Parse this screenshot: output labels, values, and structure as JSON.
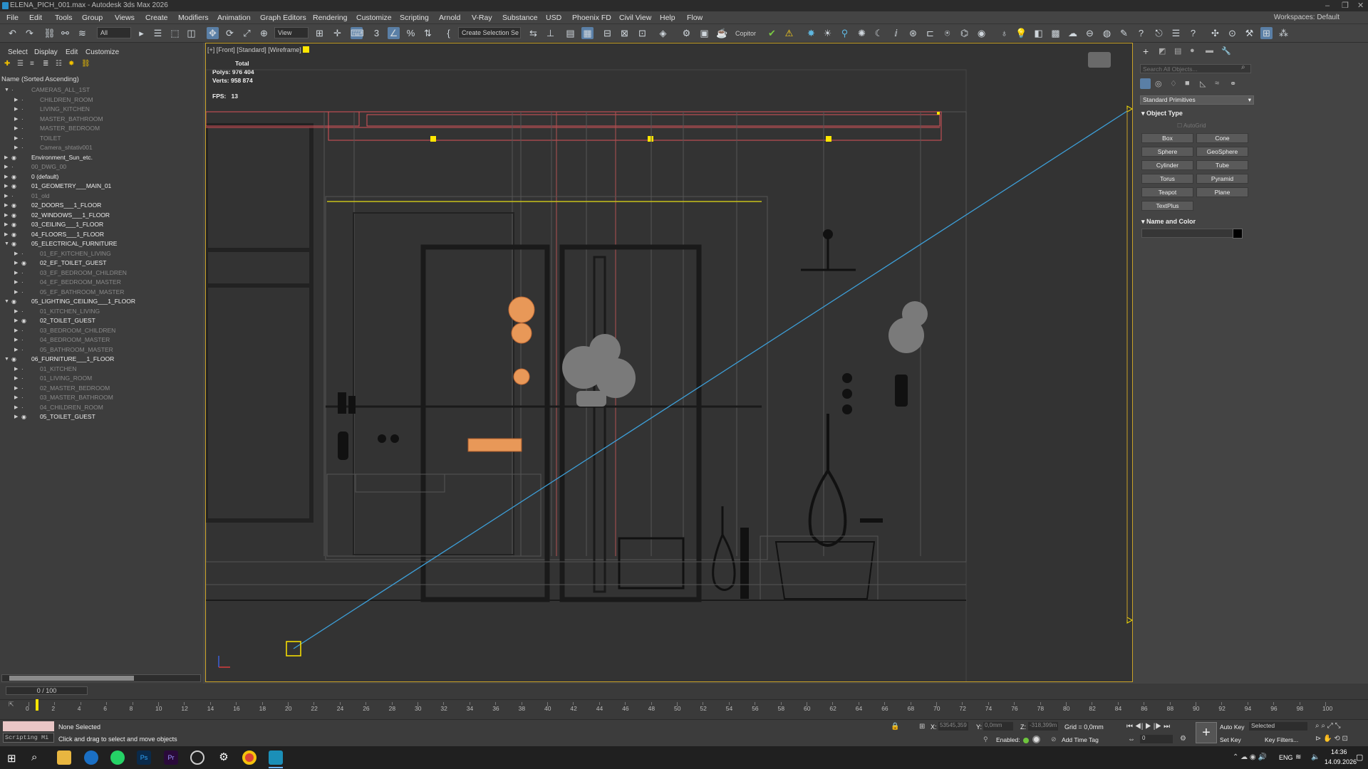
{
  "app": {
    "title": "ELENA_PICH_001.max - Autodesk 3ds Max 2026",
    "workspace_label": "Workspaces:",
    "workspace_value": "Default"
  },
  "menu": [
    "File",
    "Edit",
    "Tools",
    "Group",
    "Views",
    "Create",
    "Modifiers",
    "Animation",
    "Graph Editors",
    "Rendering",
    "Customize",
    "Scripting",
    "Arnold",
    "V-Ray",
    "Substance",
    "USD",
    "Phoenix FD",
    "Civil View",
    "Help",
    "Flow"
  ],
  "toolbar": {
    "filter_all": "All",
    "view_dropdown": "View",
    "selection_set": "Create Selection Se",
    "copitor": "Copitor"
  },
  "scene_explorer": {
    "tabs": [
      "Select",
      "Display",
      "Edit",
      "Customize"
    ],
    "sort_label": "Name (Sorted Ascending)",
    "items": [
      {
        "label": "CAMERAS_ALL_1ST",
        "dim": true,
        "level": 0,
        "expanded": true
      },
      {
        "label": "CHILDREN_ROOM",
        "dim": true,
        "level": 1
      },
      {
        "label": "LIVING_KITCHEN",
        "dim": true,
        "level": 1
      },
      {
        "label": "MASTER_BATHROOM",
        "dim": true,
        "level": 1
      },
      {
        "label": "MASTER_BEDROOM",
        "dim": true,
        "level": 1
      },
      {
        "label": "TOILET",
        "dim": true,
        "level": 1
      },
      {
        "label": "Camera_shtativ001",
        "dim": true,
        "level": 1
      },
      {
        "label": "Environment_Sun_etc.",
        "dim": false,
        "level": 0
      },
      {
        "label": "00_DWG_00",
        "dim": true,
        "level": 0
      },
      {
        "label": "0 (default)",
        "dim": false,
        "level": 0
      },
      {
        "label": "01_GEOMETRY___MAIN_01",
        "dim": false,
        "level": 0
      },
      {
        "label": "01_old",
        "dim": true,
        "level": 0
      },
      {
        "label": "02_DOORS___1_FLOOR",
        "dim": false,
        "level": 0
      },
      {
        "label": "02_WINDOWS___1_FLOOR",
        "dim": false,
        "level": 0
      },
      {
        "label": "03_CEILING___1_FLOOR",
        "dim": false,
        "level": 0
      },
      {
        "label": "04_FLOORS___1_FLOOR",
        "dim": false,
        "level": 0
      },
      {
        "label": "05_ELECTRICAL_FURNITURE",
        "dim": false,
        "level": 0,
        "expanded": true
      },
      {
        "label": "01_EF_KITCHEN_LIVING",
        "dim": true,
        "level": 1
      },
      {
        "label": "02_EF_TOILET_GUEST",
        "dim": false,
        "level": 1
      },
      {
        "label": "03_EF_BEDROOM_CHILDREN",
        "dim": true,
        "level": 1
      },
      {
        "label": "04_EF_BEDROOM_MASTER",
        "dim": true,
        "level": 1
      },
      {
        "label": "05_EF_BATHROOM_MASTER",
        "dim": true,
        "level": 1
      },
      {
        "label": "05_LIGHTING_CEILING___1_FLOOR",
        "dim": false,
        "level": 0,
        "expanded": true
      },
      {
        "label": "01_KITCHEN_LIVING",
        "dim": true,
        "level": 1
      },
      {
        "label": "02_TOILET_GUEST",
        "dim": false,
        "level": 1
      },
      {
        "label": "03_BEDROOM_CHILDREN",
        "dim": true,
        "level": 1
      },
      {
        "label": "04_BEDROOM_MASTER",
        "dim": true,
        "level": 1
      },
      {
        "label": "05_BATHROOM_MASTER",
        "dim": true,
        "level": 1
      },
      {
        "label": "06_FURNITURE___1_FLOOR",
        "dim": false,
        "level": 0,
        "expanded": true
      },
      {
        "label": "01_KITCHEN",
        "dim": true,
        "level": 1
      },
      {
        "label": "01_LIVING_ROOM",
        "dim": true,
        "level": 1
      },
      {
        "label": "02_MASTER_BEDROOM",
        "dim": true,
        "level": 1
      },
      {
        "label": "03_MASTER_BATHROOM",
        "dim": true,
        "level": 1
      },
      {
        "label": "04_CHILDREN_ROOM",
        "dim": true,
        "level": 1
      },
      {
        "label": "05_TOILET_GUEST",
        "dim": false,
        "level": 1
      }
    ]
  },
  "viewport": {
    "label": "[+] [Front] [Standard] [Wireframe]",
    "stats_total": "Total",
    "polys_label": "Polys:",
    "polys": "976 404",
    "verts_label": "Verts:",
    "verts": "958 874",
    "fps_label": "FPS:",
    "fps": "13"
  },
  "command_panel": {
    "search_placeholder": "Search All Objects...",
    "category": "Standard Primitives",
    "object_type_header": "Object Type",
    "autogrid": "AutoGrid",
    "buttons": [
      "Box",
      "Cone",
      "Sphere",
      "GeoSphere",
      "Cylinder",
      "Tube",
      "Torus",
      "Pyramid",
      "Teapot",
      "Plane",
      "TextPlus"
    ],
    "name_color_header": "Name and Color"
  },
  "timeline": {
    "frame": "0 / 100",
    "ticks": [
      0,
      2,
      4,
      6,
      8,
      10,
      12,
      14,
      16,
      18,
      20,
      22,
      24,
      26,
      28,
      30,
      32,
      34,
      36,
      38,
      40,
      42,
      44,
      46,
      48,
      50,
      52,
      54,
      56,
      58,
      60,
      62,
      64,
      66,
      68,
      70,
      72,
      74,
      76,
      78,
      80,
      82,
      84,
      86,
      88,
      90,
      92,
      94,
      96,
      98,
      100
    ]
  },
  "status": {
    "script_label": "Scripting Mi",
    "selection": "None Selected",
    "prompt": "Click and drag to select and move objects",
    "x_label": "X:",
    "x_value": "53545,359",
    "y_label": "Y:",
    "y_value": "0,0mm",
    "z_label": "Z:",
    "z_value": "-318,399m",
    "grid": "Grid = 0,0mm",
    "enabled": "Enabled:",
    "add_time_tag": "Add Time Tag",
    "auto_key": "Auto Key",
    "set_key": "Set Key",
    "selected": "Selected",
    "key_filters": "Key Filters...",
    "frame_field": "0"
  },
  "taskbar": {
    "time": "14:36",
    "date": "14.09.2026",
    "lang": "ENG"
  },
  "colors": {
    "accent": "#5a7fa6",
    "viewport_border": "#c9a227",
    "blue_line": "#3d9fd8",
    "yellow": "#ffe600",
    "orange": "#e89858",
    "red": "#d9535a"
  }
}
